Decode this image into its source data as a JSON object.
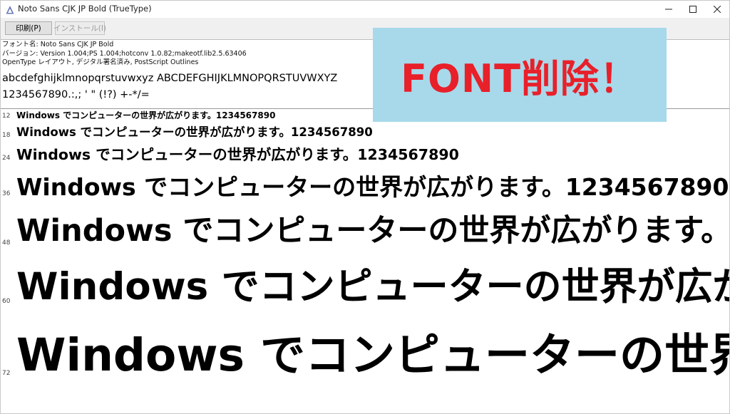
{
  "window": {
    "title": "Noto Sans CJK JP Bold (TrueType)"
  },
  "toolbar": {
    "print_label": "印刷(P)",
    "install_label": "インストール(I)"
  },
  "font_info": {
    "name_line": "フォント名: Noto Sans CJK JP Bold",
    "version_line": "バージョン: Version 1.004;PS 1.004;hotconv 1.0.82;makeotf.lib2.5.63406",
    "type_line": "OpenType レイアウト, デジタル署名済み, PostScript Outlines"
  },
  "samples": {
    "alphabet": "abcdefghijklmnopqrstuvwxyz ABCDEFGHIJKLMNOPQRSTUVWXYZ",
    "digits": "1234567890.:,; ' \" (!?) +-*/="
  },
  "preview": {
    "sentence": "Windows でコンピューターの世界が広がります。1234567890",
    "rows": [
      {
        "size_label": "12"
      },
      {
        "size_label": "18"
      },
      {
        "size_label": "24"
      },
      {
        "size_label": "36"
      },
      {
        "size_label": "48"
      },
      {
        "size_label": "60"
      },
      {
        "size_label": "72"
      }
    ]
  },
  "overlay": {
    "text": "FONT削除！",
    "background_color": "#a7d9ea",
    "text_color": "#e8202a"
  }
}
